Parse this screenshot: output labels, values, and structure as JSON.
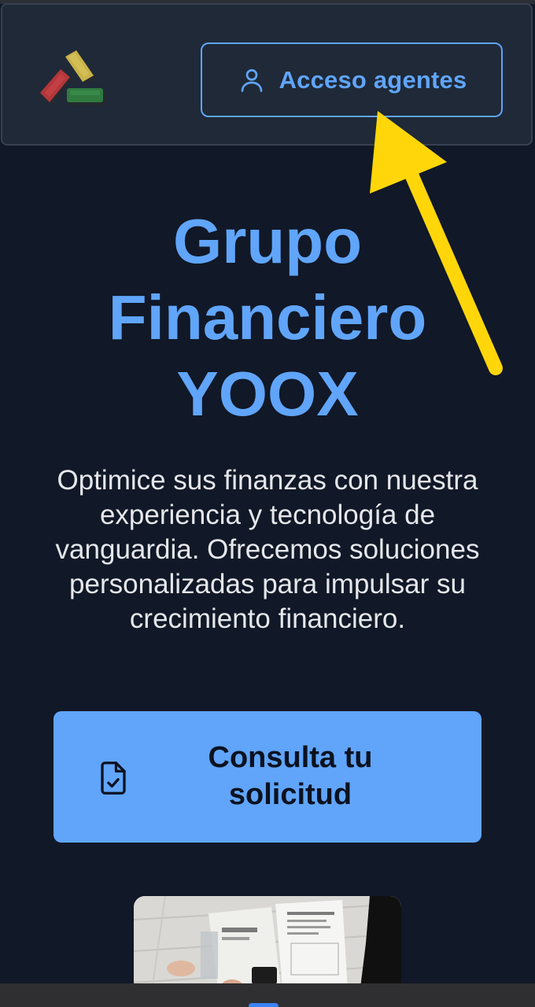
{
  "header": {
    "logo_icon": "brand-logo-icon",
    "agent_button": {
      "label": "Acceso agentes",
      "icon": "user-icon"
    }
  },
  "hero": {
    "title_lines": [
      "Grupo",
      "Financiero",
      "YOOX"
    ],
    "description": "Optimice sus finanzas con nuestra experiencia y tecnología de vanguardia. Ofrecemos soluciones personalizadas para impulsar su crecimiento financiero."
  },
  "cta": {
    "label_lines": [
      "Consulta tu",
      "solicitud"
    ],
    "icon": "document-check-icon"
  },
  "annotation": {
    "arrow_icon": "yellow-arrow-icon",
    "arrow_color": "#FFD60A"
  },
  "colors": {
    "background": "#111827",
    "header": "#1F2937",
    "accent": "#60A5FA"
  }
}
